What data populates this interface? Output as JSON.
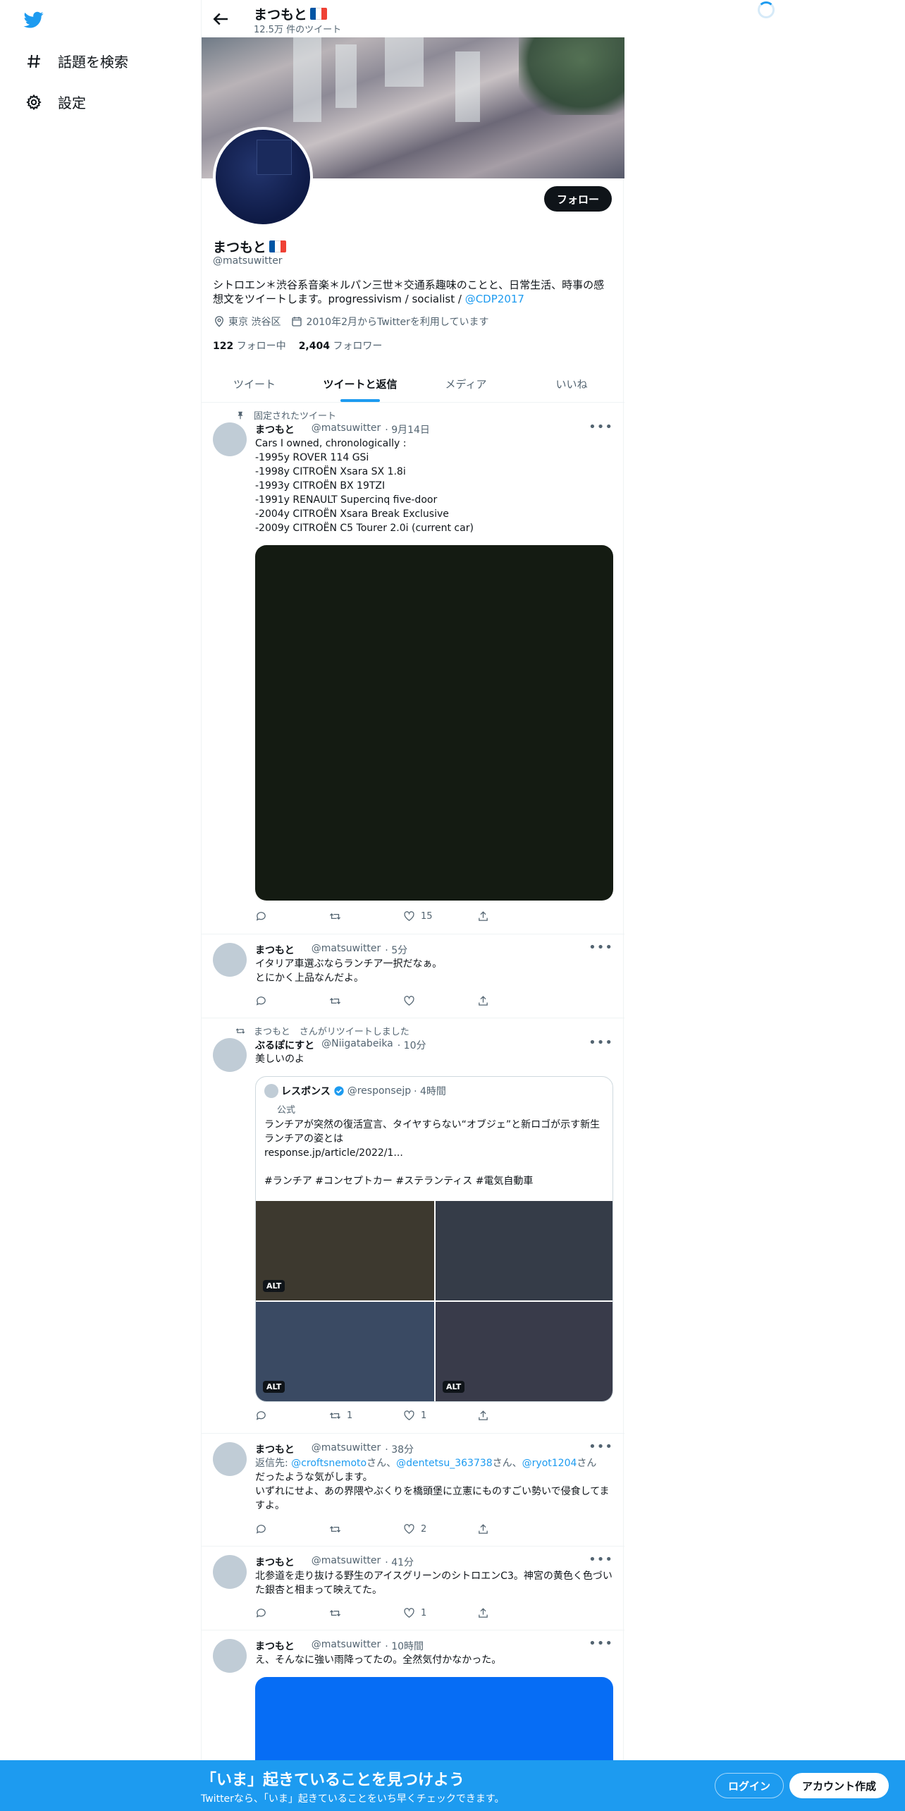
{
  "nav": {
    "explore": "話題を検索",
    "settings": "設定"
  },
  "header": {
    "name": "まつもと",
    "tweet_count": "12.5万 件のツイート"
  },
  "profile": {
    "name": "まつもと",
    "handle": "@matsuwitter",
    "follow_label": "フォロー",
    "bio_text": "シトロエン＊渋谷系音楽＊ルパン三世＊交通系趣味のことと、日常生活、時事の感想文をツイートします。progressivism / socialist / ",
    "bio_link": "@CDP2017",
    "location": "東京 渋谷区",
    "joined": "2010年2月からTwitterを利用しています",
    "following_count": "122",
    "following_label": "フォロー中",
    "followers_count": "2,404",
    "followers_label": "フォロワー"
  },
  "tabs": [
    "ツイート",
    "ツイートと返信",
    "メディア",
    "いいね"
  ],
  "tweets": [
    {
      "context": "固定されたツイート",
      "name": "まつもと",
      "handle": "@matsuwitter",
      "time": "· 9月14日",
      "text": "Cars I owned, chronologically :\n-1995y ROVER 114 GSi\n-1998y CITROËN Xsara SX 1.8i\n-1993y CITROËN BX 19TZI\n-1991y RENAULT Supercinq five-door\n-2004y CITROËN Xsara Break Exclusive\n-2009y CITROËN C5 Tourer 2.0i (current car)",
      "like_count": "15",
      "retweet_count": ""
    },
    {
      "name": "まつもと",
      "handle": "@matsuwitter",
      "time": "· 5分",
      "text": "イタリア車選ぶならランチア一択だなぁ。\nとにかく上品なんだよ。"
    },
    {
      "context": "まつもと　さんがリツイートしました",
      "name": "ぶるぽにすと",
      "handle": "@Niigatabeika",
      "time": "· 10分",
      "text": "美しいのよ",
      "retweet_count": "1",
      "like_count": "1",
      "quote": {
        "name": "レスポンス",
        "handle": "@responsejp",
        "time": "· 4時間",
        "badge": "公式",
        "text": "ランチアが突然の復活宣言、タイヤすらない“オブジェ”と新ロゴが示す新生ランチアの姿とは\nresponse.jp/article/2022/1...\n\n#ランチア #コンセプトカー #ステランティス #電気自動車",
        "alt": "ALT"
      }
    },
    {
      "name": "まつもと",
      "handle": "@matsuwitter",
      "time": "· 38分",
      "reply_prefix": "返信先: ",
      "reply_1": "@croftsnemoto",
      "reply_san_1": "さん、",
      "reply_2": "@dentetsu_363738",
      "reply_san_2": "さん、",
      "reply_3": "@ryot1204",
      "reply_san_3": "さん",
      "text": "だったような気がします。\nいずれにせよ、あの界隈やぶくりを橋頭堡に立憲にものすごい勢いで侵食してますよ。",
      "like_count": "2"
    },
    {
      "name": "まつもと",
      "handle": "@matsuwitter",
      "time": "· 41分",
      "text": "北参道を走り抜ける野生のアイスグリーンのシトロエンC3。神宮の黄色く色づいた銀杏と相まって映えてた。",
      "like_count": "1"
    },
    {
      "name": "まつもと",
      "handle": "@matsuwitter",
      "time": "· 10時間",
      "text": "え、そんなに強い雨降ってたの。全然気付かなかった。"
    }
  ],
  "bottom": {
    "title": "「いま」起きていることを見つけよう",
    "subtitle": "Twitterなら、「いま」起きていることをいち早くチェックできます。",
    "login": "ログイン",
    "signup": "アカウント作成"
  },
  "colors": {
    "accent": "#1d9bf0",
    "text": "#0f1419",
    "muted": "#536471",
    "flag": [
      "#0055a4",
      "#ffffff",
      "#ef4135"
    ]
  }
}
